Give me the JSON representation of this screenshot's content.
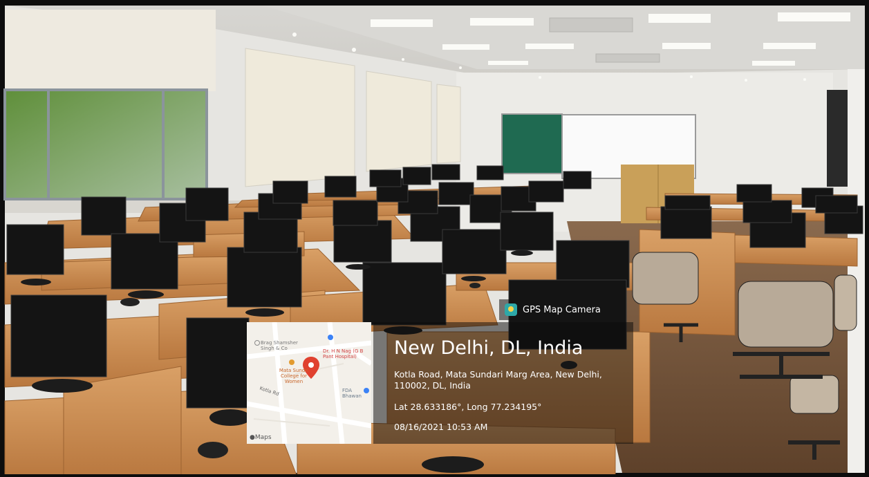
{
  "overlay": {
    "app_name": "GPS Map Camera",
    "location_title": "New Delhi, DL, India",
    "address": "Kotla Road, Mata Sundari Marg Area, New Delhi, 110002, DL, India",
    "coordinates": "Lat 28.633186°, Long 77.234195°",
    "datetime": "08/16/2021 10:53 AM"
  },
  "map": {
    "provider_label": "Maps",
    "labels": {
      "bragg": "Brag Shamsher Singh & Co",
      "college": "Mata Sundri College for Women",
      "hospital": "Dr. H N Nag (G B Pant Hospital)",
      "road": "Kotla Rd",
      "fda": "FDA Bhawan"
    }
  },
  "colors": {
    "desk_wood": "#c8894a",
    "monitor": "#151515",
    "wall": "#e9e8e4",
    "floor": "#6b4c33",
    "pin": "#e0412f"
  }
}
